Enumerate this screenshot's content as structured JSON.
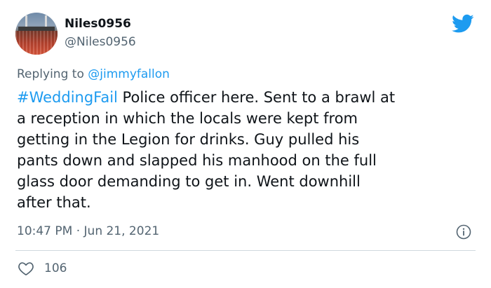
{
  "user": {
    "display_name": "Niles0956",
    "handle": "@Niles0956"
  },
  "reply": {
    "prefix": "Replying to ",
    "mention": "@jimmyfallon"
  },
  "tweet": {
    "hashtag": "#WeddingFail",
    "lines": [
      " Police officer here. Sent to a brawl at",
      "a reception in which the locals were kept from",
      "getting in the Legion for drinks. Guy pulled his",
      "pants down and slapped his manhood on the full",
      "glass door demanding to get in. Went downhill",
      "after that."
    ],
    "timestamp": "10:47 PM · Jun 21, 2021",
    "like_count": "106"
  },
  "colors": {
    "accent": "#1d9bf0",
    "secondary_text": "#536471",
    "divider": "#cfd9de"
  },
  "icons": {
    "brand": "twitter-bird-icon",
    "info": "info-icon",
    "like": "heart-icon"
  }
}
